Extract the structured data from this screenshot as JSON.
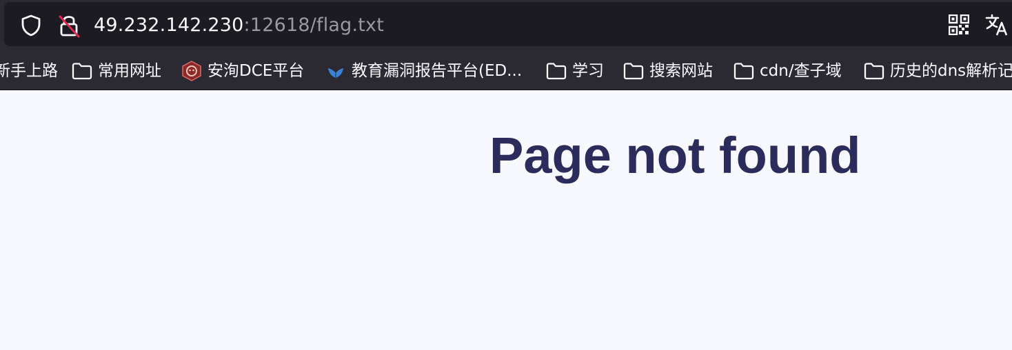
{
  "browser": {
    "url_host": "49.232.142.230",
    "url_rest": ":12618/flag.txt",
    "icons": {
      "tracking": "shield-icon",
      "security": "insecure-lock-icon",
      "qr": "qr-code-icon",
      "translate": "translate-icon"
    }
  },
  "bookmarks": [
    {
      "label": "新手上路",
      "icon": "none"
    },
    {
      "label": "常用网址",
      "icon": "folder-icon"
    },
    {
      "label": "安洵DCE平台",
      "icon": "dce-logo-icon"
    },
    {
      "label": "教育漏洞报告平台(ED...",
      "icon": "edu-logo-icon"
    },
    {
      "label": "学习",
      "icon": "folder-icon"
    },
    {
      "label": "搜索网站",
      "icon": "folder-icon"
    },
    {
      "label": "cdn/查子域",
      "icon": "folder-icon"
    },
    {
      "label": "历史的dns解析记",
      "icon": "folder-icon"
    }
  ],
  "page": {
    "title": "Page not found",
    "title_color": "#2b2c5b",
    "background": "#f8f9fe"
  }
}
